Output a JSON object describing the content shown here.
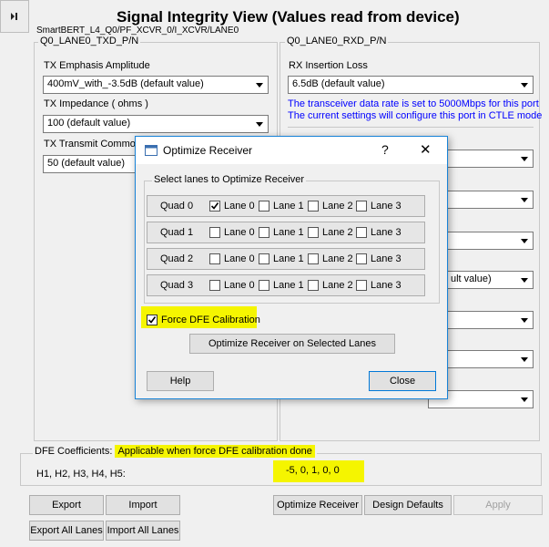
{
  "toolbar": {
    "collapse_icon": "play-pause-icon"
  },
  "header": {
    "title": "Signal Integrity View (Values read from device)",
    "path": "SmartBERT_L4_Q0/PF_XCVR_0/I_XCVR/LANE0"
  },
  "tx": {
    "group_title": "Q0_LANE0_TXD_P/N",
    "emphasis_label": "TX Emphasis Amplitude",
    "emphasis_value": "400mV_with_-3.5dB (default value)",
    "impedance_label": "TX Impedance ( ohms )",
    "impedance_value": "100 (default value)",
    "common_label": "TX Transmit Common",
    "common_value": "50 (default value)"
  },
  "rx": {
    "group_title": "Q0_LANE0_RXD_P/N",
    "insertion_label": "RX Insertion Loss",
    "insertion_value": "6.5dB (default value)",
    "info_line1": "The transceiver data rate is set to 5000Mbps for this port",
    "info_line2": "The current settings will configure this port in CTLE mode",
    "partial_value": "ult value)"
  },
  "dfe": {
    "group_title": "DFE Coefficients: ",
    "note": "Applicable when force DFE calibration done",
    "coef_label": "H1, H2, H3, H4, H5:",
    "coef_values": "-5, 0, 1, 0, 0"
  },
  "buttons": {
    "export": "Export",
    "import": "Import",
    "export_all": "Export All Lanes",
    "import_all": "Import All Lanes",
    "optimize": "Optimize Receiver",
    "defaults": "Design Defaults",
    "apply": "Apply"
  },
  "dialog": {
    "title": "Optimize Receiver",
    "help_glyph": "?",
    "close_glyph": "✕",
    "lanes_group": "Select lanes to Optimize Receiver",
    "quads": [
      {
        "name": "Quad 0",
        "lanes": [
          {
            "label": "Lane 0",
            "checked": true
          },
          {
            "label": "Lane 1",
            "checked": false
          },
          {
            "label": "Lane 2",
            "checked": false
          },
          {
            "label": "Lane 3",
            "checked": false
          }
        ]
      },
      {
        "name": "Quad 1",
        "lanes": [
          {
            "label": "Lane 0",
            "checked": false
          },
          {
            "label": "Lane 1",
            "checked": false
          },
          {
            "label": "Lane 2",
            "checked": false
          },
          {
            "label": "Lane 3",
            "checked": false
          }
        ]
      },
      {
        "name": "Quad 2",
        "lanes": [
          {
            "label": "Lane 0",
            "checked": false
          },
          {
            "label": "Lane 1",
            "checked": false
          },
          {
            "label": "Lane 2",
            "checked": false
          },
          {
            "label": "Lane 3",
            "checked": false
          }
        ]
      },
      {
        "name": "Quad 3",
        "lanes": [
          {
            "label": "Lane 0",
            "checked": false
          },
          {
            "label": "Lane 1",
            "checked": false
          },
          {
            "label": "Lane 2",
            "checked": false
          },
          {
            "label": "Lane 3",
            "checked": false
          }
        ]
      }
    ],
    "force_dfe_label": "Force DFE Calibration",
    "force_dfe_checked": true,
    "optimize_selected": "Optimize Receiver on Selected Lanes",
    "help_button": "Help",
    "close_button": "Close"
  },
  "colors": {
    "highlight": "#f5f500",
    "info_text": "#0000ff",
    "dialog_border": "#1883d7"
  }
}
